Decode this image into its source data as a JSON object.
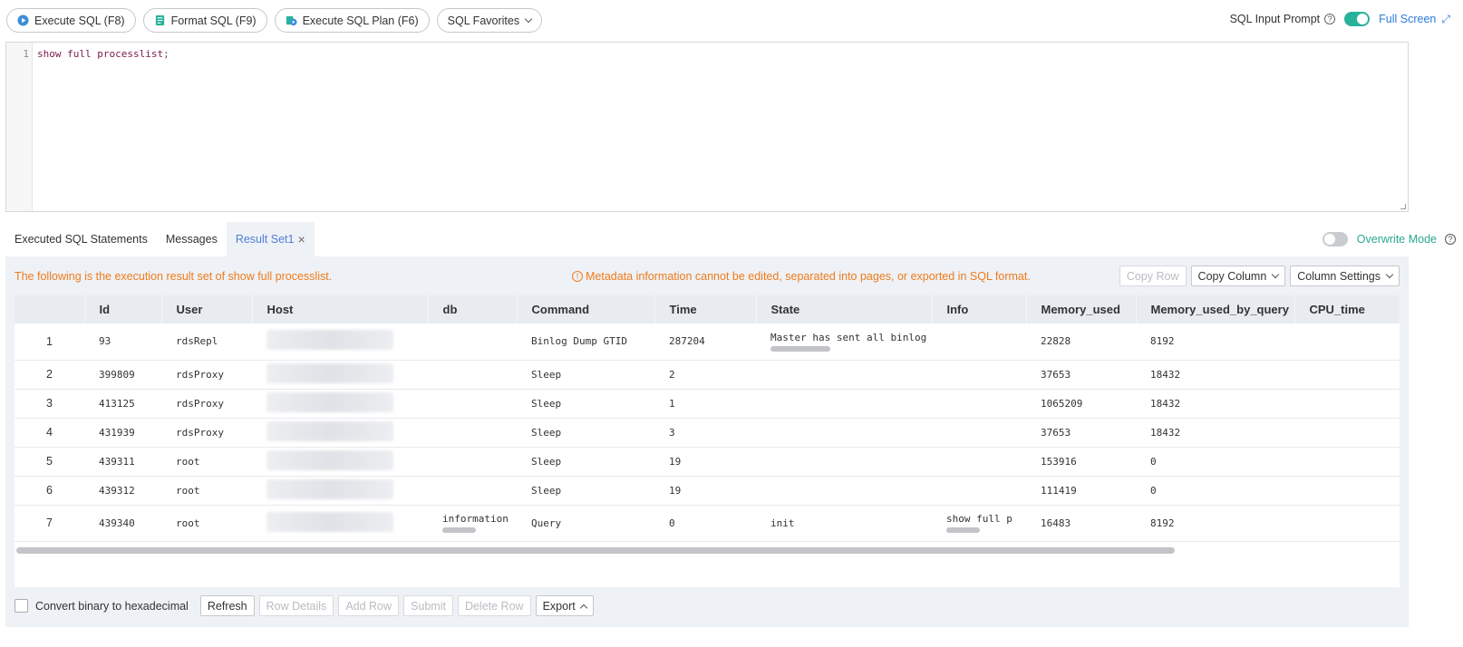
{
  "toolbar": {
    "execute_sql": "Execute SQL (F8)",
    "format_sql": "Format SQL (F9)",
    "execute_plan": "Execute SQL Plan (F6)",
    "favorites": "SQL Favorites",
    "input_prompt": "SQL Input Prompt",
    "input_prompt_on": true,
    "full_screen": "Full Screen"
  },
  "editor": {
    "line_number": "1",
    "code": "show full processlist",
    "terminator": ";"
  },
  "tabs": [
    {
      "label": "Executed SQL Statements"
    },
    {
      "label": "Messages"
    },
    {
      "label": "Result Set1",
      "active": true
    }
  ],
  "overwrite_mode": {
    "label": "Overwrite Mode",
    "on": false
  },
  "result": {
    "info_left": "The following is the execution result set of show full processlist.",
    "info_mid": "Metadata information cannot be edited, separated into pages, or exported in SQL format.",
    "copy_row": "Copy Row",
    "copy_column": "Copy Column",
    "column_settings": "Column Settings",
    "columns": [
      "",
      "Id",
      "User",
      "Host",
      "db",
      "Command",
      "Time",
      "State",
      "Info",
      "Memory_used",
      "Memory_used_by_query",
      "CPU_time"
    ],
    "rows": [
      {
        "n": "1",
        "id": "93",
        "user": "rdsRepl",
        "db": "",
        "command": "Binlog Dump GTID",
        "time": "287204",
        "state": "Master has sent all binlog",
        "info": "",
        "mem": "22828",
        "memq": "8192",
        "cpu": ""
      },
      {
        "n": "2",
        "id": "399809",
        "user": "rdsProxy",
        "db": "",
        "command": "Sleep",
        "time": "2",
        "state": "",
        "info": "",
        "mem": "37653",
        "memq": "18432",
        "cpu": ""
      },
      {
        "n": "3",
        "id": "413125",
        "user": "rdsProxy",
        "db": "",
        "command": "Sleep",
        "time": "1",
        "state": "",
        "info": "",
        "mem": "1065209",
        "memq": "18432",
        "cpu": ""
      },
      {
        "n": "4",
        "id": "431939",
        "user": "rdsProxy",
        "db": "",
        "command": "Sleep",
        "time": "3",
        "state": "",
        "info": "",
        "mem": "37653",
        "memq": "18432",
        "cpu": ""
      },
      {
        "n": "5",
        "id": "439311",
        "user": "root",
        "db": "",
        "command": "Sleep",
        "time": "19",
        "state": "",
        "info": "",
        "mem": "153916",
        "memq": "0",
        "cpu": ""
      },
      {
        "n": "6",
        "id": "439312",
        "user": "root",
        "db": "",
        "command": "Sleep",
        "time": "19",
        "state": "",
        "info": "",
        "mem": "111419",
        "memq": "0",
        "cpu": ""
      },
      {
        "n": "7",
        "id": "439340",
        "user": "root",
        "db": "information",
        "command": "Query",
        "time": "0",
        "state": "init",
        "info": "show full p",
        "mem": "16483",
        "memq": "8192",
        "cpu": ""
      }
    ]
  },
  "footer": {
    "convert_label": "Convert binary to hexadecimal",
    "refresh": "Refresh",
    "row_details": "Row Details",
    "add_row": "Add Row",
    "submit": "Submit",
    "delete_row": "Delete Row",
    "export": "Export"
  },
  "colors": {
    "accent": "#29b29b",
    "link": "#2a7bdc",
    "warning": "#f07b1a",
    "tab_active": "#4f7ed8"
  }
}
